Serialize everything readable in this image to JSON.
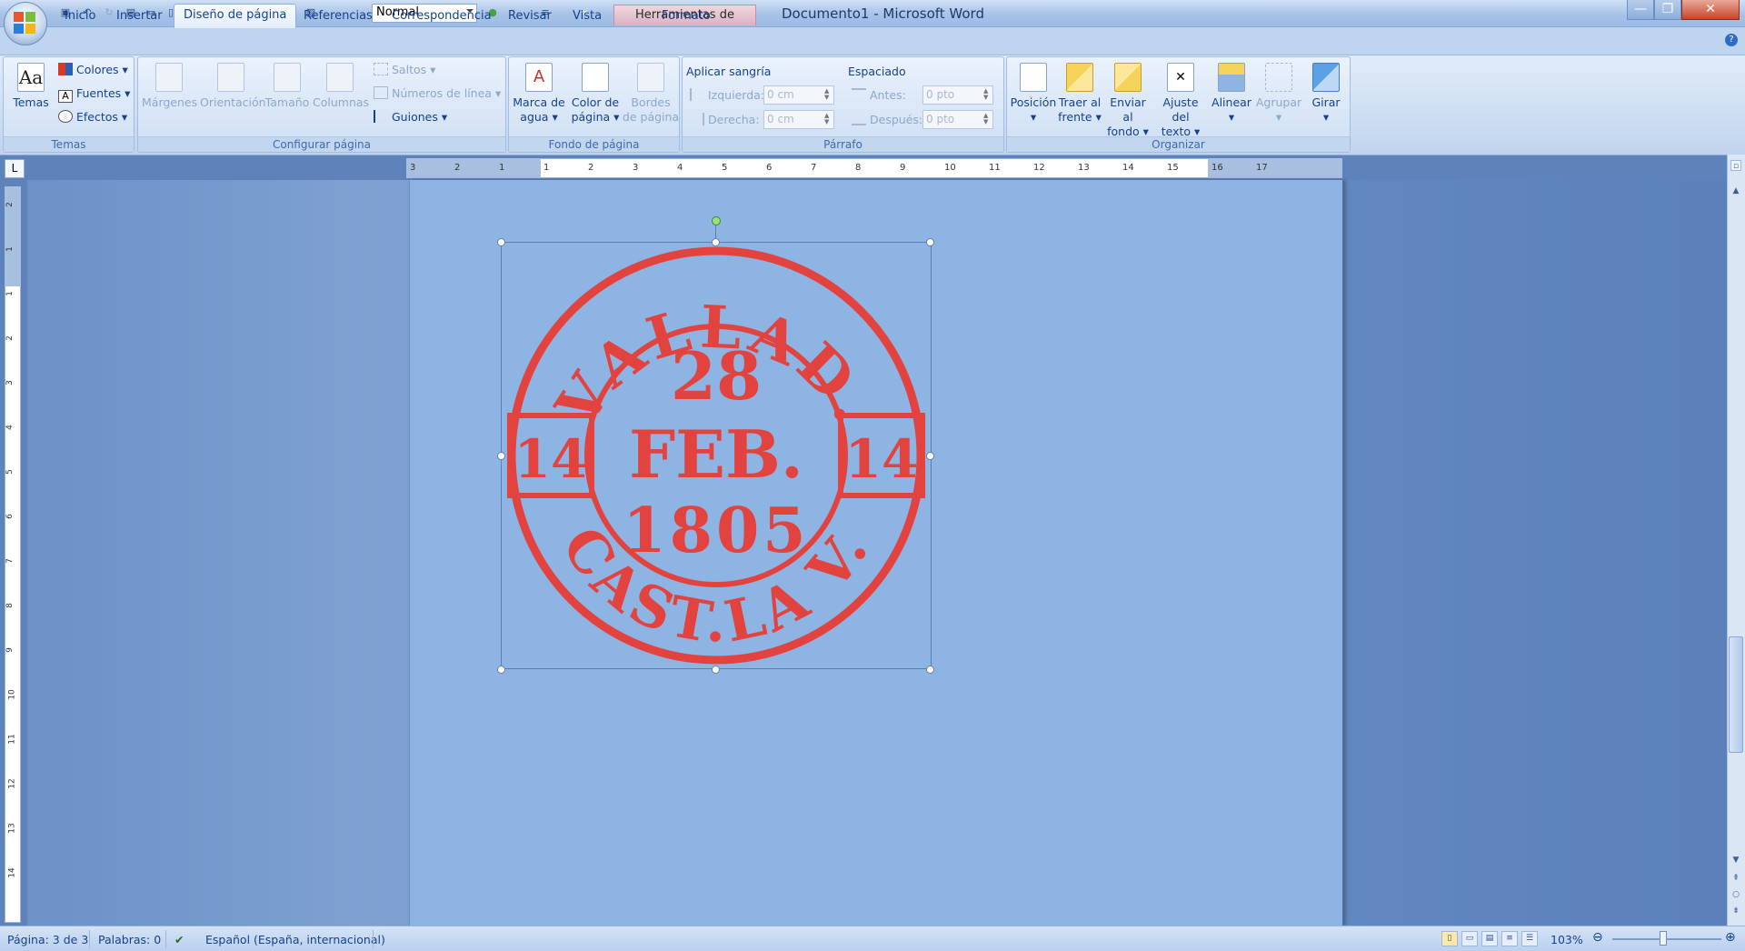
{
  "window": {
    "doc_title": "Documento1 - Microsoft Word",
    "context_tab": "Herramientas de imagen",
    "style_box_value": "Normal",
    "qat_more": "»"
  },
  "tabs": [
    {
      "label": "Inicio"
    },
    {
      "label": "Insertar"
    },
    {
      "label": "Diseño de página"
    },
    {
      "label": "Referencias"
    },
    {
      "label": "Correspondencia"
    },
    {
      "label": "Revisar"
    },
    {
      "label": "Vista"
    },
    {
      "label": "Formato"
    }
  ],
  "ribbon": {
    "temas": {
      "group_label": "Temas",
      "temas_btn": "Temas",
      "colores": "Colores",
      "fuentes": "Fuentes",
      "efectos": "Efectos"
    },
    "configurar": {
      "group_label": "Configurar página",
      "margenes": "Márgenes",
      "orientacion": "Orientación",
      "tamano": "Tamaño",
      "columnas": "Columnas",
      "saltos": "Saltos",
      "numeros": "Números de línea",
      "guiones": "Guiones"
    },
    "fondo": {
      "group_label": "Fondo de página",
      "marca_1": "Marca de",
      "marca_2": "agua",
      "color_1": "Color de",
      "color_2": "página",
      "bordes_1": "Bordes",
      "bordes_2": "de página"
    },
    "parrafo": {
      "group_label": "Párrafo",
      "sangria": "Aplicar sangría",
      "espaciado": "Espaciado",
      "izquierda_label": "Izquierda:",
      "izquierda_value": "0 cm",
      "derecha_label": "Derecha:",
      "derecha_value": "0 cm",
      "antes_label": "Antes:",
      "antes_value": "0 pto",
      "despues_label": "Después:",
      "despues_value": "0 pto"
    },
    "organizar": {
      "group_label": "Organizar",
      "posicion": "Posición",
      "traer_1": "Traer al",
      "traer_2": "frente",
      "enviar_1": "Enviar al",
      "enviar_2": "fondo",
      "ajuste_1": "Ajuste del",
      "ajuste_2": "texto",
      "alinear": "Alinear",
      "agrupar": "Agrupar",
      "girar": "Girar"
    }
  },
  "ruler": {
    "tab_selector": "L",
    "h_ticks": [
      "3",
      "2",
      "1",
      "1",
      "2",
      "3",
      "4",
      "5",
      "6",
      "7",
      "8",
      "9",
      "10",
      "11",
      "12",
      "13",
      "14",
      "15",
      "16",
      "17"
    ],
    "v_ticks": [
      "2",
      "1",
      "1",
      "2",
      "3",
      "4",
      "5",
      "6",
      "7",
      "8",
      "9",
      "10",
      "11",
      "12",
      "13",
      "14"
    ]
  },
  "stamp": {
    "top_arc": "VALLAD.",
    "day": "28",
    "month": "FEB.",
    "year": "1805",
    "left_num": "14",
    "right_num": "14",
    "bottom_arc": "CAST.LA V.",
    "color": "#e2433f"
  },
  "status": {
    "page": "Página: 3 de 3",
    "words": "Palabras: 0",
    "language": "Español (España, internacional)",
    "zoom": "103%"
  }
}
